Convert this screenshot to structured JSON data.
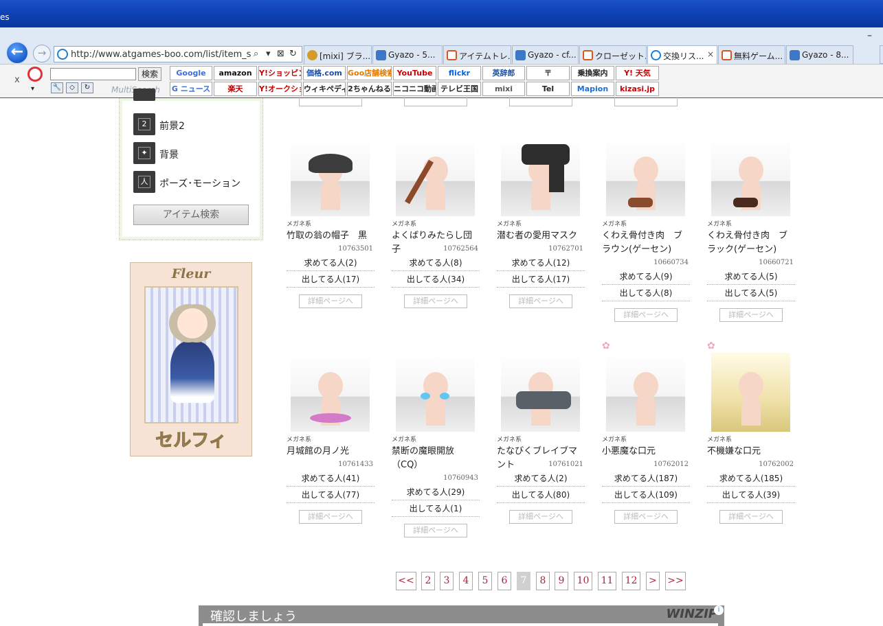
{
  "window": {
    "title_fragment": "es",
    "minimize": "–"
  },
  "nav": {
    "back": "←",
    "forward": "→",
    "url": "http://www.atgames-boo.com/list/item_sear",
    "search_glyph": "⌕",
    "dropdown_glyph": "▾",
    "compat_glyph": "⊠",
    "refresh_glyph": "↻"
  },
  "tabs": [
    {
      "label": "[mixi] ブラ...",
      "icon": "mixi"
    },
    {
      "label": "Gyazo - 5...",
      "icon": "gyazo"
    },
    {
      "label": "アイテムトレ...",
      "icon": "at"
    },
    {
      "label": "Gyazo - cf...",
      "icon": "gyazo"
    },
    {
      "label": "クローゼット...",
      "icon": "at"
    },
    {
      "label": "交換リス...",
      "icon": "ie2",
      "active": true,
      "close": "×"
    },
    {
      "label": "無料ゲーム...",
      "icon": "at"
    },
    {
      "label": "Gyazo - 8...",
      "icon": "gyazo"
    }
  ],
  "toolbar": {
    "close": "x",
    "search_button": "検索",
    "brand": "MultiSearch",
    "arrow": "▾",
    "tool_icons": [
      "wrench-icon",
      "eraser-icon",
      "sync-icon"
    ],
    "quick_row1": [
      {
        "label": "Google",
        "color": "#3b6fd6"
      },
      {
        "label": "amazon",
        "color": "#111"
      },
      {
        "label": "Y!ショッピング",
        "color": "#c00"
      },
      {
        "label": "価格.com",
        "color": "#1b4fa6"
      },
      {
        "label": "Goo店舗検索",
        "color": "#e07b00"
      },
      {
        "label": "YouTube",
        "color": "#c00"
      },
      {
        "label": "flickr",
        "color": "#0063dc"
      },
      {
        "label": "英辞郎",
        "color": "#1b4fa6"
      },
      {
        "label": "〒",
        "color": "#333"
      },
      {
        "label": "乗換案内",
        "color": "#222"
      },
      {
        "label": "Y! 天気",
        "color": "#c00"
      }
    ],
    "quick_row2": [
      {
        "label": "G ニュース",
        "color": "#3b6fd6"
      },
      {
        "label": "楽天",
        "color": "#bf0000"
      },
      {
        "label": "Y!オークション",
        "color": "#c00"
      },
      {
        "label": "ウィキペディア",
        "color": "#222"
      },
      {
        "label": "2ちゃんねる",
        "color": "#222"
      },
      {
        "label": "ニコニコ動画",
        "color": "#222"
      },
      {
        "label": "テレビ王国",
        "color": "#222"
      },
      {
        "label": "mixi",
        "color": "#555"
      },
      {
        "label": "Tel",
        "color": "#222"
      },
      {
        "label": "Mapion",
        "color": "#1b6fd6"
      },
      {
        "label": "kizasi.jp",
        "color": "#c00"
      }
    ]
  },
  "sidebar": {
    "items": [
      {
        "label": "前景2",
        "icon_text": "2"
      },
      {
        "label": "背景",
        "icon_text": "✦"
      },
      {
        "label": "ポーズ･モーション",
        "icon_text": "人"
      }
    ],
    "partial_item_icon": "1",
    "search_button": "アイテム検索"
  },
  "banner": {
    "top_text": "Fleur",
    "bottom_text": "セルフィ"
  },
  "items": [
    {
      "cat": "メガネ系",
      "name": "竹取の翁の帽子　黒",
      "code": "10763501",
      "want": "求めてる人(2)",
      "have": "出してる人(17)",
      "detail": "詳細ページへ"
    },
    {
      "cat": "メガネ系",
      "name": "よくばりみたらし団子",
      "code": "10762564",
      "want": "求めてる人(8)",
      "have": "出してる人(34)",
      "detail": "詳細ページへ"
    },
    {
      "cat": "メガネ系",
      "name": "潜む者の愛用マスク",
      "code": "10762701",
      "want": "求めてる人(12)",
      "have": "出してる人(17)",
      "detail": "詳細ページへ"
    },
    {
      "cat": "メガネ系",
      "name": "くわえ骨付き肉　ブラウン(ゲーセン)",
      "code": "10660734",
      "want": "求めてる人(9)",
      "have": "出してる人(8)",
      "detail": "詳細ページへ"
    },
    {
      "cat": "メガネ系",
      "name": "くわえ骨付き肉　ブラック(ゲーセン)",
      "code": "10660721",
      "want": "求めてる人(5)",
      "have": "出してる人(5)",
      "detail": "詳細ページへ"
    },
    {
      "cat": "メガネ系",
      "name": "月城館の月ノ光",
      "code": "10761433",
      "want": "求めてる人(41)",
      "have": "出してる人(77)",
      "detail": "詳細ページへ"
    },
    {
      "cat": "メガネ系",
      "name": "禁断の魔眼開放（CQ）",
      "code": "10760943",
      "want": "求めてる人(29)",
      "have": "出してる人(1)",
      "detail": "詳細ページへ"
    },
    {
      "cat": "メガネ系",
      "name": "たなびくブレイブマント",
      "code": "10761021",
      "want": "求めてる人(2)",
      "have": "出してる人(80)",
      "detail": "詳細ページへ"
    },
    {
      "cat": "メガネ系",
      "name": "小悪魔な口元",
      "code": "10762012",
      "want": "求めてる人(187)",
      "have": "出してる人(109)",
      "detail": "詳細ページへ"
    },
    {
      "cat": "メガネ系",
      "name": "不機嫌な口元",
      "code": "10762002",
      "want": "求めてる人(185)",
      "have": "出してる人(39)",
      "detail": "詳細ページへ"
    }
  ],
  "partial_detail": "詳細ページへ",
  "pagination": [
    "<<",
    "2",
    "3",
    "4",
    "5",
    "6",
    "7",
    "8",
    "9",
    "10",
    "11",
    "12",
    ">",
    ">>"
  ],
  "current_page": "7",
  "ad": {
    "title": "確認しましょう",
    "brand": "WINZIP",
    "info": "i"
  }
}
